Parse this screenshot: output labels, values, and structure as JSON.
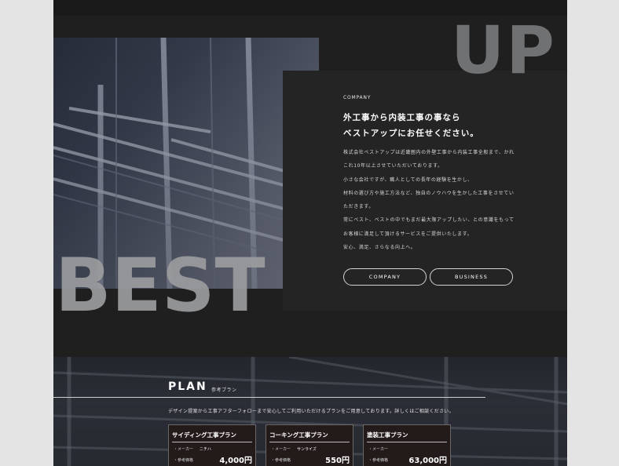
{
  "hero": {
    "big_word_top": "UP",
    "big_word_bottom": "BEST",
    "section_label": "COMPANY",
    "headline_lines": [
      "外工事から内装工事の事なら",
      "ベストアップにお任せください。"
    ],
    "body_lines": [
      "株式会社ベストアップは近畿圏内の外壁工事から内装工事全般まで、かれ",
      "これ10年以上させていただいております。",
      "小さな会社ですが、職人としての長年の経験を生かし、",
      "材料の選び方や施工方法など、独自のノウハウを生かした工事をさせてい",
      "ただきます。",
      "常にベスト、ベストの中でもまだ最大限アップしたい、との意識をもって",
      "お客様に満足して頂けるサービスをご提供いたします。",
      "安心、満足、さらなる向上へ。"
    ],
    "buttons": {
      "company": "COMPANY",
      "business": "BUSINESS"
    }
  },
  "plan": {
    "title": "PLAN",
    "subtitle": "参考プラン",
    "description": "デザイン提案から工事アフターフォローまで安心してご利用いただけるプランをご用意しております。詳しくはご相談ください。",
    "cards": [
      {
        "title": "サイディング工事プラン",
        "maker_label": "・メーカー",
        "maker_value": "ニチハ",
        "price_label": "・参考価格",
        "price": "4,000円"
      },
      {
        "title": "コーキング工事プラン",
        "maker_label": "・メーカー",
        "maker_value": "サンライズ",
        "price_label": "・参考価格",
        "price": "550円"
      },
      {
        "title": "塗装工事プラン",
        "maker_label": "・メーカー",
        "maker_value": "",
        "price_label": "・参考価格",
        "price": "63,000円"
      }
    ]
  },
  "colors": {
    "page_background": "#1f1f20",
    "panel": "#242425",
    "outer_background": "#e4e4e4",
    "card_background": "#231a1a"
  }
}
